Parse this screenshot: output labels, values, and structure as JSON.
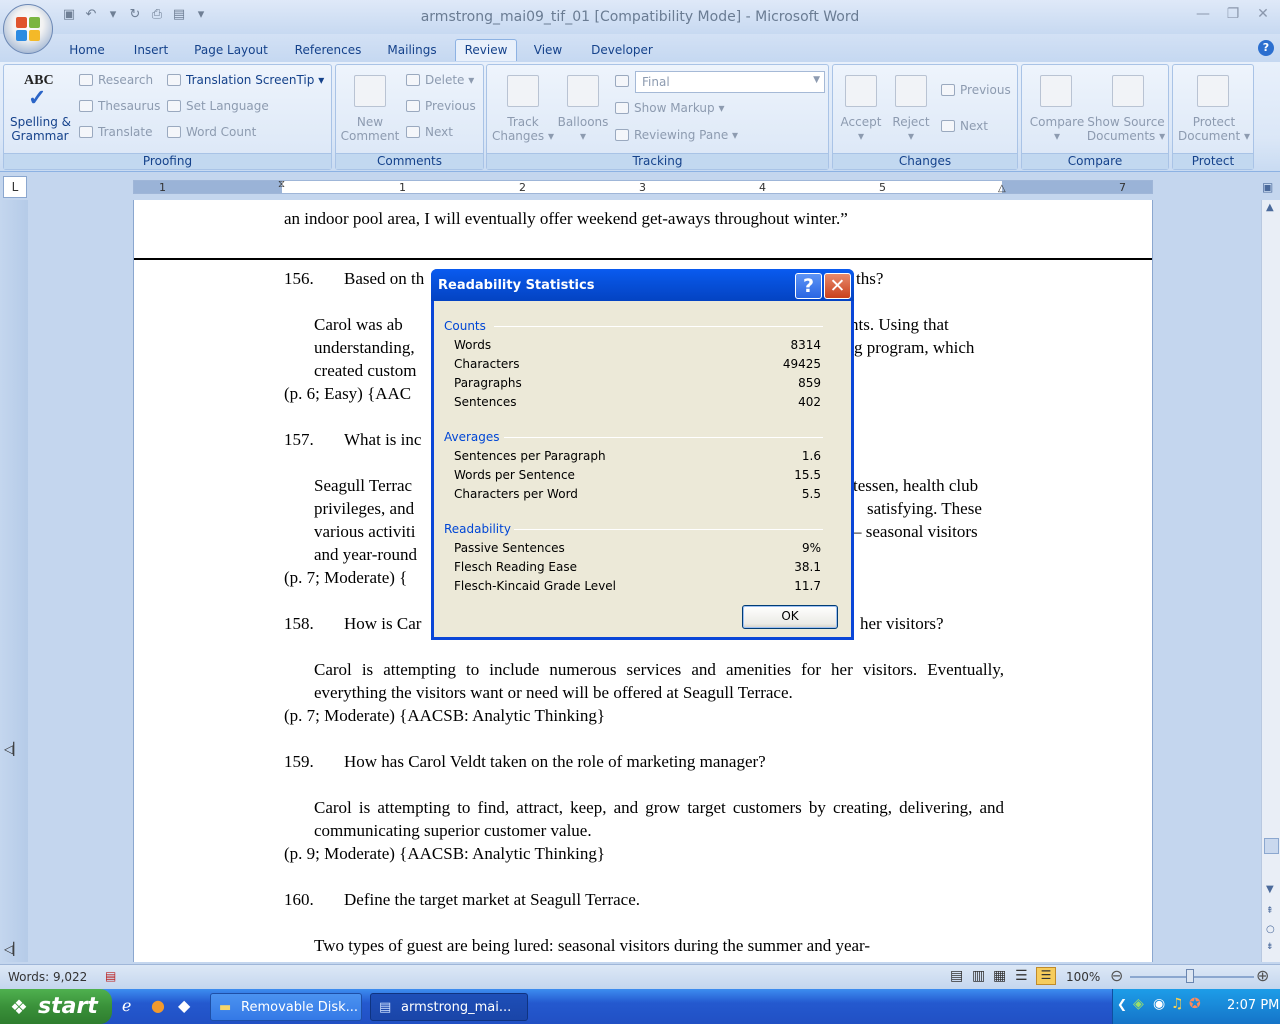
{
  "window": {
    "title": "armstrong_mai09_tif_01 [Compatibility Mode] - Microsoft Word"
  },
  "tabs": [
    "Home",
    "Insert",
    "Page Layout",
    "References",
    "Mailings",
    "Review",
    "View",
    "Developer"
  ],
  "ribbon": {
    "proofing": {
      "label": "Proofing",
      "spelling": "Spelling &",
      "grammar": "Grammar",
      "research": "Research",
      "thesaurus": "Thesaurus",
      "translate": "Translate",
      "screentip": "Translation ScreenTip",
      "set_language": "Set Language",
      "word_count": "Word Count"
    },
    "comments": {
      "label": "Comments",
      "new1": "New",
      "new2": "Comment",
      "delete": "Delete",
      "previous": "Previous",
      "next": "Next"
    },
    "tracking": {
      "label": "Tracking",
      "track1": "Track",
      "track2": "Changes",
      "balloons": "Balloons",
      "display": "Final",
      "show_markup": "Show Markup",
      "reviewing_pane": "Reviewing Pane"
    },
    "changes": {
      "label": "Changes",
      "accept": "Accept",
      "reject": "Reject",
      "previous": "Previous",
      "next": "Next"
    },
    "compare": {
      "label": "Compare",
      "compare": "Compare",
      "show1": "Show Source",
      "show2": "Documents"
    },
    "protect": {
      "label": "Protect",
      "p1": "Protect",
      "p2": "Document"
    }
  },
  "ruler": [
    "1",
    "1",
    "2",
    "3",
    "4",
    "5",
    "7"
  ],
  "document": {
    "line_top": "an indoor pool area, I will eventually offer weekend get-aways throughout winter.”",
    "q156_num": "156.",
    "q156": "Based on th",
    "q156_end": "ths?",
    "a156_l1a": "Carol was ab",
    "a156_l1b": "vants. Using that",
    "a156_l2a": "understanding,",
    "a156_l2b": "g program, which",
    "a156_l3": "created custom",
    "r156": "(p. 6; Easy) {AAC",
    "q157_num": "157.",
    "q157": "What is inc",
    "a157_l1a": "Seagull Terrac",
    "a157_l1b": "tessen, health club",
    "a157_l2a": "privileges, and",
    "a157_l2b": "satisfying. These",
    "a157_l3a": "various activiti",
    "a157_l3b": "– seasonal visitors",
    "a157_l4": "and year-round",
    "r157": "(p. 7; Moderate) {",
    "q158_num": "158.",
    "q158": "How is Car",
    "q158_end": "her visitors?",
    "a158": "Carol is attempting to include numerous services and amenities for her visitors. Eventually, everything the visitors want or need will be offered at Seagull Terrace.",
    "r158": "(p. 7; Moderate) {AACSB: Analytic Thinking}",
    "q159_num": "159.",
    "q159": "How has Carol Veldt taken on the role of marketing manager?",
    "a159": "Carol is attempting to find, attract, keep, and grow target customers by creating, delivering, and communicating superior customer value.",
    "r159": "(p. 9; Moderate) {AACSB: Analytic Thinking}",
    "q160_num": "160.",
    "q160": "Define the target market at Seagull Terrace.",
    "a160": "Two types of guest are being lured: seasonal visitors during the summer and year-"
  },
  "dialog": {
    "title": "Readability Statistics",
    "help": "?",
    "counts_label": "Counts",
    "counts": [
      {
        "k": "Words",
        "v": "8314"
      },
      {
        "k": "Characters",
        "v": "49425"
      },
      {
        "k": "Paragraphs",
        "v": "859"
      },
      {
        "k": "Sentences",
        "v": "402"
      }
    ],
    "averages_label": "Averages",
    "averages": [
      {
        "k": "Sentences per Paragraph",
        "v": "1.6"
      },
      {
        "k": "Words per Sentence",
        "v": "15.5"
      },
      {
        "k": "Characters per Word",
        "v": "5.5"
      }
    ],
    "readability_label": "Readability",
    "readability": [
      {
        "k": "Passive Sentences",
        "v": "9%"
      },
      {
        "k": "Flesch Reading Ease",
        "v": "38.1"
      },
      {
        "k": "Flesch-Kincaid Grade Level",
        "v": "11.7"
      }
    ],
    "ok": "OK"
  },
  "status": {
    "words": "Words: 9,022",
    "zoom": "100%"
  },
  "taskbar": {
    "start": "start",
    "item1": "Removable Disk...",
    "item2": "armstrong_mai...",
    "clock": "2:07 PM"
  },
  "colors": {
    "titlebar": "#c7d9f1",
    "dialog_title": "#0751dc",
    "taskbar": "#2459cf",
    "start": "#3a913a"
  }
}
